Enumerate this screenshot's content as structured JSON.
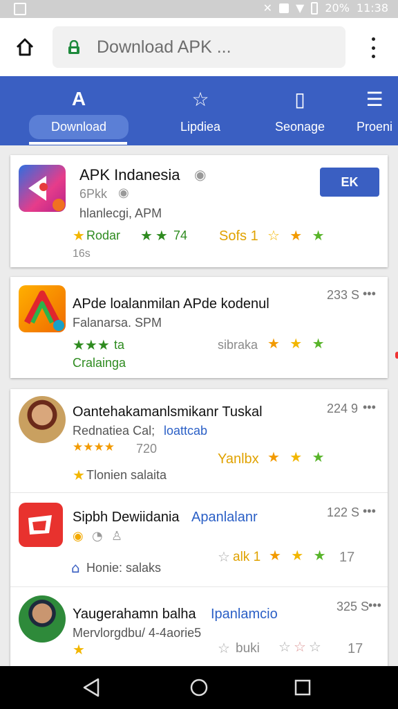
{
  "status_bar": {
    "battery": "20%",
    "time": "11:38"
  },
  "browser": {
    "url": "Download APK ..."
  },
  "tabs": [
    {
      "label": "Download",
      "icon": "apk-logo-icon"
    },
    {
      "label": "Lipdiea",
      "icon": "star-icon"
    },
    {
      "label": "Seonage",
      "icon": "tablet-icon"
    },
    {
      "label": "Proeni",
      "icon": "list-icon"
    }
  ],
  "featured": {
    "title": "APK Indanesia",
    "publisher": "6Pkk",
    "meta": "hlanlecgi, APM",
    "rating_text": "Rodar",
    "rating_count": "74",
    "promo_label": "Sofs 1",
    "downloads": "16s",
    "install_label": "EK"
  },
  "second": {
    "title": "APde loalanmilan APde kodenul",
    "subtitle": "Falanarsa. SPM",
    "rating": "ta",
    "category": "Cralainga",
    "badge_label": "sibraka",
    "size": "233 S"
  },
  "list": [
    {
      "title": "Oantehakamanlsmikanr Tuskal",
      "subtitle_a": "Rednatiea Cal;",
      "subtitle_b": "loattcab",
      "rating": "720",
      "tag": "Tlonien salaita",
      "badge": "Yanlbx",
      "size": "224 9"
    },
    {
      "title": "Sipbh Dewiidania",
      "title_accent": "Apanlalanr",
      "tag": "Honie: salaks",
      "badge": "alk 1",
      "extra": "17",
      "size": "122 S"
    },
    {
      "title": "Yaugerahamn balha",
      "title_accent": "Ipanlamcio",
      "subtitle": "Mervlorgdbu/ 4-4aorie5",
      "badge": "buki",
      "extra": "17",
      "size": "325 S"
    }
  ],
  "colors": {
    "primary": "#3a5fc2",
    "star_yellow": "#f2b600",
    "star_green": "#58b42a",
    "text_green": "#2e8b1f"
  }
}
